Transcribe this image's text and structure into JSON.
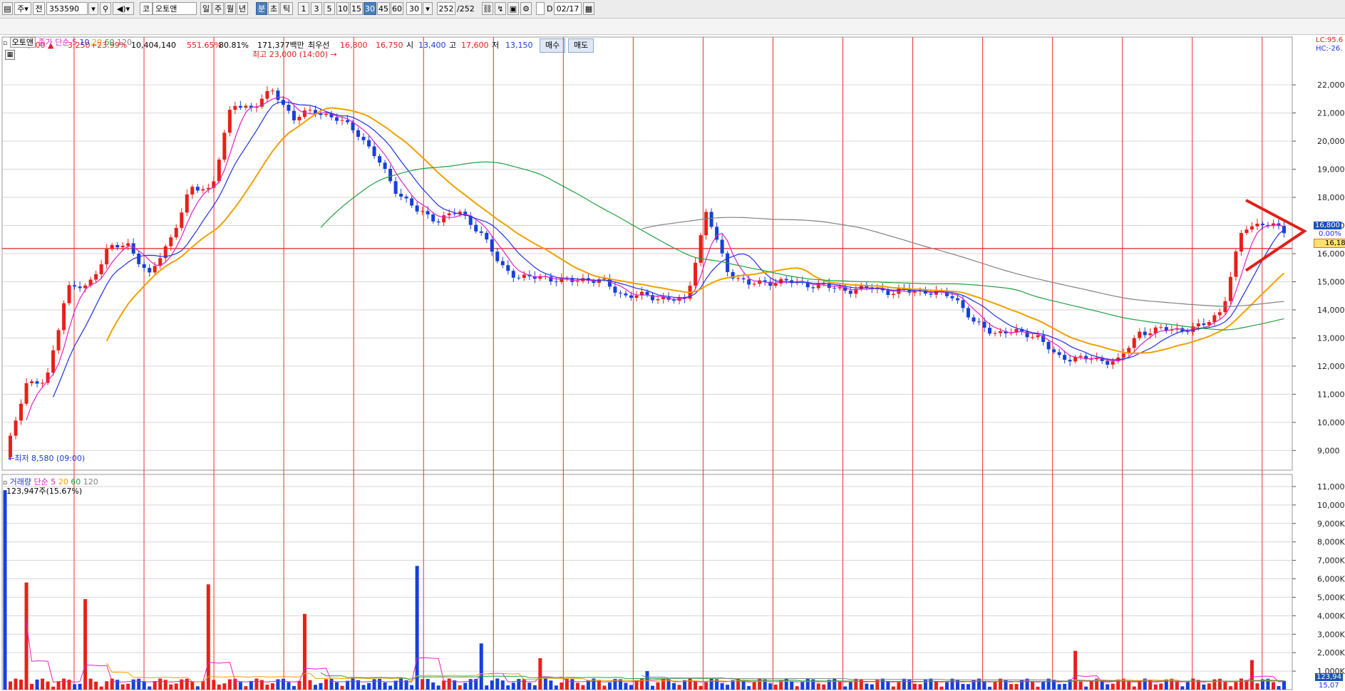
{
  "toolbar": {
    "period_prefix": "주",
    "code_label": "전",
    "stock_code": "353590",
    "market": "코",
    "stock_name": "오토앤",
    "period_tabs": [
      "일",
      "주",
      "월",
      "년",
      "분",
      "초",
      "틱"
    ],
    "active_period": "분",
    "intervals": [
      "1",
      "3",
      "5",
      "10",
      "15",
      "30",
      "45",
      "60"
    ],
    "active_interval": "30",
    "interval_select": "30",
    "count": "252",
    "count_total": "/252",
    "d_label": "D",
    "date": "02/17"
  },
  "quote": {
    "price": "16,800 ▲",
    "change": "3,250",
    "change_pct": "+23.99%",
    "volume": "10,404,140",
    "volume_ratio": "551.65%",
    "turnover_ratio": "80.81%",
    "amount": "171,377백만",
    "best_ask_label": "최우선",
    "best_ask": "16,800",
    "best_bid": "16,750",
    "open_label": "시",
    "open": "13,400",
    "high_label": "고",
    "high": "17,600",
    "low_label": "저",
    "low": "13,150",
    "buy_label": "매수",
    "sell_label": "매도"
  },
  "price_panel": {
    "name": "오토앤",
    "ma_label": "종가 단순",
    "ma_periods": [
      "5",
      "10",
      "20",
      "60",
      "120"
    ],
    "high_annotation": "최고 23,000 (14:00)",
    "low_annotation": "최저 8,580 (09:00)",
    "lc_label": "LC:95.6",
    "hc_label": "HC:-26.",
    "current_price_label": "16,800",
    "current_pct_label": "0.00%",
    "ref_price_label": "16,18"
  },
  "volume_panel": {
    "name": "거래량",
    "ma_label": "단순",
    "ma_periods": [
      "5",
      "20",
      "60",
      "120"
    ],
    "volume_annotation": "123,947주(15.67%)",
    "current_volume_label": "123,94",
    "bottom_label": "15,07"
  },
  "colors": {
    "up": "#e8201a",
    "down": "#1740d8",
    "ma5": "#e020c8",
    "ma10": "#2030e0",
    "ma20": "#f0a000",
    "ma60": "#20a040",
    "ma120": "#808080",
    "grid": "#d6d6d6",
    "session_line": "#e83030"
  },
  "chart_data": [
    {
      "type": "candlestick",
      "series_meaning": "30-minute OHLC",
      "y_ticks": [
        "22,000",
        "21,000",
        "20,000",
        "19,000",
        "18,000",
        "17,000",
        "16,000",
        "15,000",
        "14,000",
        "13,000",
        "12,000",
        "11,000",
        "10,000",
        "9,000"
      ],
      "ylim": [
        8300,
        23700
      ],
      "close_path": [
        8700,
        11400,
        11400,
        14800,
        14800,
        16200,
        16300,
        15200,
        16500,
        18300,
        18300,
        21300,
        21200,
        21800,
        20800,
        21100,
        20800,
        20400,
        19400,
        18200,
        17500,
        17200,
        17500,
        16800,
        15600,
        15100,
        15200,
        15000,
        15100,
        15000,
        14500,
        14500,
        14400,
        14300,
        17500,
        15400,
        14900,
        15000,
        15000,
        14900,
        14800,
        14700,
        14800,
        14600,
        14700,
        14600,
        14500,
        13500,
        13200,
        13200,
        13100,
        12300,
        12300,
        12200,
        12200,
        13200,
        13300,
        13300,
        13400,
        14000,
        16900,
        17100,
        16800
      ],
      "ma_last_values": {
        "ma5": 17000,
        "ma10": 16400,
        "ma20": 15200,
        "ma60": 13800,
        "ma120": 14300
      },
      "reference_line": 16180,
      "triangle_pattern": true
    },
    {
      "type": "bar",
      "series_meaning": "volume",
      "y_ticks": [
        "11,000K",
        "10,000K",
        "9,000K",
        "8,000K",
        "7,000K",
        "6,000K",
        "5,000K",
        "4,000K",
        "3,000K",
        "2,000K",
        "1,000K"
      ],
      "ylim": [
        0,
        11500
      ],
      "unit": "K shares",
      "notable_bars": [
        {
          "approx_x_index": 0,
          "value": 10800
        },
        {
          "approx_x_index": 1,
          "value": 5800
        },
        {
          "approx_x_index": 2,
          "value": 4900
        },
        {
          "approx_x_index": 3,
          "value": 5700
        },
        {
          "approx_x_index": 4,
          "value": 4100
        },
        {
          "approx_x_index": 5,
          "value": 6700
        },
        {
          "approx_x_index": 6,
          "value": 2500
        },
        {
          "approx_x_index": 7,
          "value": 1700
        },
        {
          "approx_x_index": 8,
          "value": 1000
        },
        {
          "approx_x_index": 9,
          "value": 2100
        },
        {
          "approx_x_index": 10,
          "value": 1600
        }
      ]
    }
  ]
}
